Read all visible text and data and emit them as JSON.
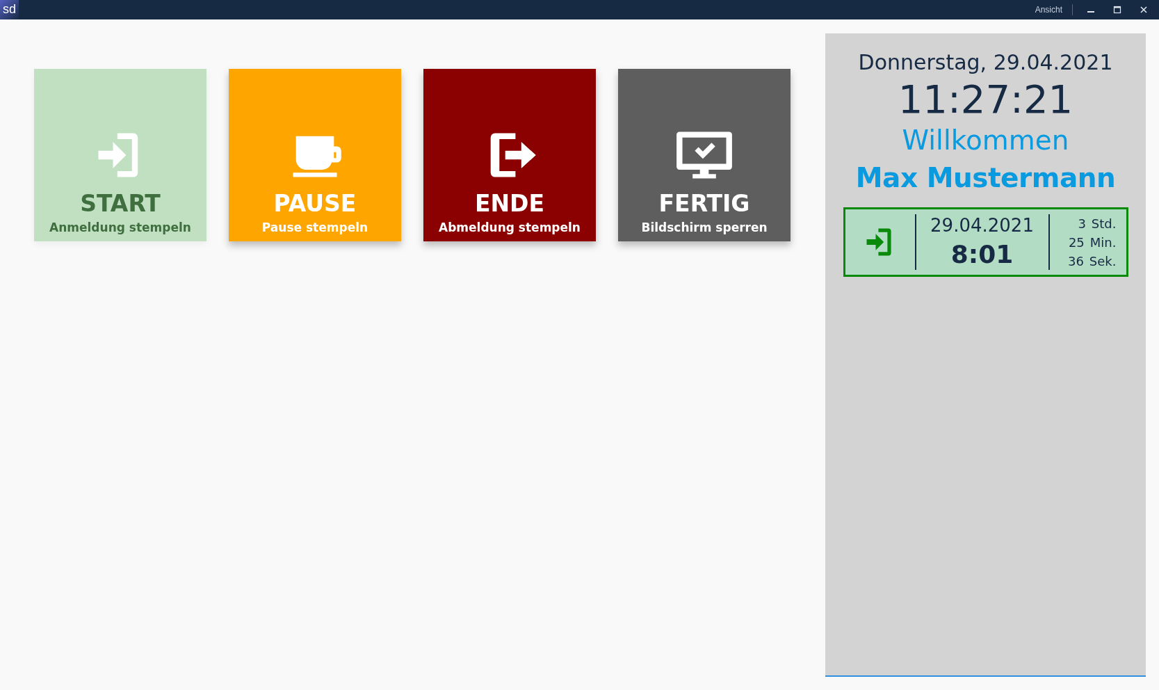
{
  "window": {
    "logo": "sd",
    "menu": "Ansicht"
  },
  "tiles": [
    {
      "kind": "login",
      "title": "START",
      "subtitle": "Anmeldung stempeln",
      "color": "#c1e0c1",
      "disabled": true
    },
    {
      "kind": "cup",
      "title": "PAUSE",
      "subtitle": "Pause stempeln",
      "color": "#ffa500",
      "disabled": false
    },
    {
      "kind": "logout",
      "title": "ENDE",
      "subtitle": "Abmeldung stempeln",
      "color": "#8b0000",
      "disabled": false
    },
    {
      "kind": "monitor",
      "title": "FERTIG",
      "subtitle": "Bildschirm sperren",
      "color": "#5e5e5e",
      "disabled": false
    }
  ],
  "panel": {
    "date": "Donnerstag, 29.04.2021",
    "time": "11:27:21",
    "greeting": "Willkommen",
    "user": "Max Mustermann",
    "last_booking": {
      "kind": "login",
      "date": "29.04.2021",
      "time": "8:01",
      "duration": [
        {
          "value": "3",
          "unit": "Std."
        },
        {
          "value": "25",
          "unit": "Min."
        },
        {
          "value": "36",
          "unit": "Sek."
        }
      ]
    }
  }
}
